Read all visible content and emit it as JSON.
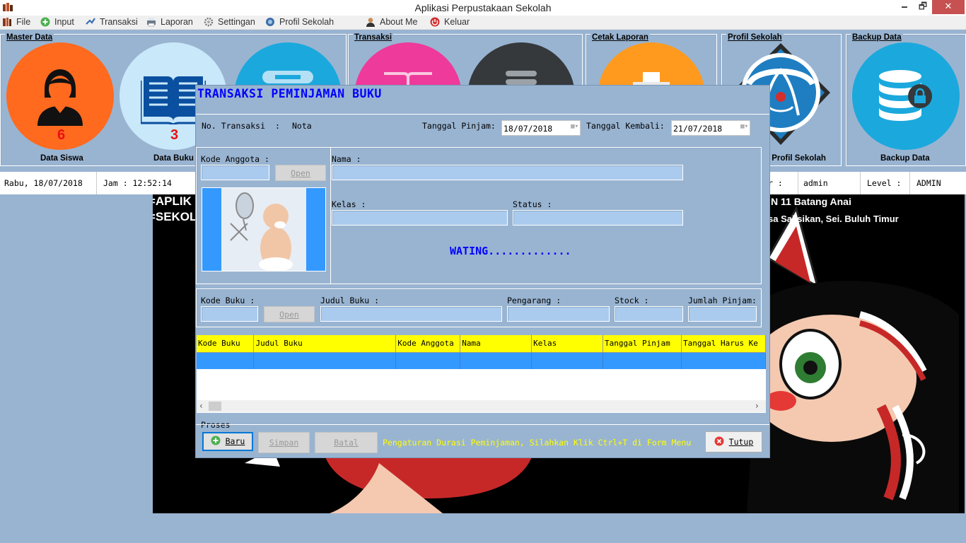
{
  "window": {
    "title": "Aplikasi Perpustakaan Sekolah",
    "minimize": "🗕",
    "maximize": "🗗",
    "close": "✕"
  },
  "menu": [
    "File",
    "Input",
    "Transaksi",
    "Laporan",
    "Settingan",
    "Profil Sekolah",
    "About Me",
    "Keluar"
  ],
  "panels": {
    "master_data": {
      "title": "Master Data",
      "siswa_label": "Data Siswa",
      "siswa_count": "6",
      "buku_label": "Data Buku",
      "buku_count": "3"
    },
    "transaksi": {
      "title": "Transaksi"
    },
    "cetak_laporan": {
      "title": "Cetak Laporan"
    },
    "profil_sekolah": {
      "title": "Profil Sekolah",
      "label": "n  Profil  Sekolah",
      "logo_text": "TUT WURI HANDAYANI"
    },
    "backup_data": {
      "title": "Backup Data",
      "label": "Backup Data"
    }
  },
  "status_bar": {
    "date": "Rabu, 18/07/2018",
    "time": "Jam : 12:52:14",
    "user_label": "r :",
    "user": "admin",
    "level_label": "Level :",
    "level": "ADMIN"
  },
  "background": {
    "line1": "==APLIK",
    "line2": "==SEKOL",
    "line3": "==",
    "right1": "N 11 Batang Anai",
    "right2": "sa Salisikan, Sei. Buluh Timur"
  },
  "dialog": {
    "title": "TRANSAKSI PEMINJAMAN BUKU",
    "no_transaksi_label": "No. Transaksi",
    "colon": ":",
    "no_transaksi_value": "Nota",
    "tanggal_pinjam_label": "Tanggal Pinjam:",
    "tanggal_pinjam_value": "18/07/2018",
    "tanggal_kembali_label": "Tanggal Kembali:",
    "tanggal_kembali_value": "21/07/2018",
    "kode_anggota_label": "Kode Anggota :",
    "open_label": "Open",
    "nama_label": "Nama :",
    "kelas_label": "Kelas :",
    "status_label": "Status :",
    "waiting_text": "WATING.............",
    "kode_buku_label": "Kode Buku :",
    "judul_buku_label": "Judul Buku :",
    "pengarang_label": "Pengarang :",
    "stock_label": "Stock :",
    "jumlah_pinjam_label": "Jumlah Pinjam:",
    "table_headers": [
      "Kode Buku",
      "Judul Buku",
      "Kode Anggota",
      "Nama",
      "Kelas",
      "Tanggal Pinjam",
      "Tanggal Harus Ke"
    ],
    "proses_label": "Proses",
    "baru_label": "Baru",
    "simpan_label": "Simpan",
    "batal_label": "Batal",
    "hint": "Pengaturan Durasi Peminjaman, Silahkan Klik Ctrl+T di Form Menu",
    "tutup_label": "Tutup"
  },
  "colors": {
    "background": "#99B4D1",
    "accent_blue": "#0000FF",
    "header_yellow": "#FFFF00",
    "row_blue": "#3399FF",
    "siswa_circle": "#FF6A1F",
    "buku_circle": "#C9E8FA",
    "cyan_circle": "#1BA8DD",
    "pink_circle": "#EE3A9B",
    "dark_circle": "#35393C",
    "orange_circle": "#FF9A1F"
  }
}
